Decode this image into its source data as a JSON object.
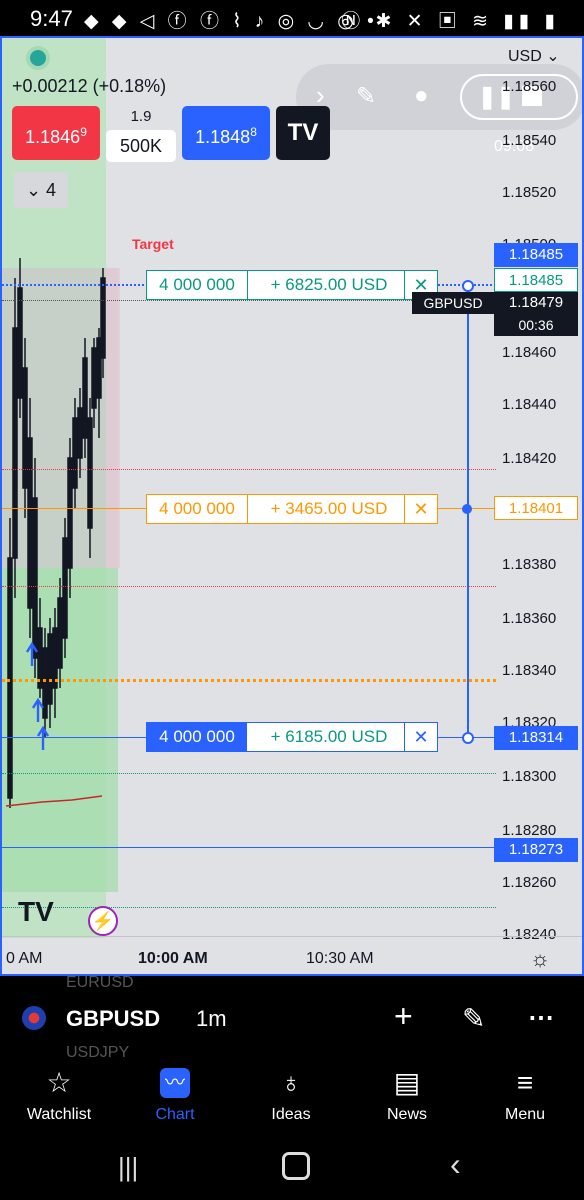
{
  "status_bar": {
    "time": "9:47",
    "left_icons": "◆ ◆ ◁ ⓕ ⓕ ⌇ ♪ ◎ ◡ ◎ •",
    "right_icons": "Ⓝ ✱ ✕ ▣ ≋ ▮▮ ▮"
  },
  "chart": {
    "currency": "USD",
    "change": "+0.00212 (+0.18%)",
    "sell_price_main": "1.1846",
    "sell_price_sup": "9",
    "spread": "1.9",
    "quantity": "500K",
    "buy_price_main": "1.1848",
    "buy_price_sup": "8",
    "indicators_count": "4",
    "target_label": "Target",
    "symbol_tag": "GBPUSD",
    "countdown": "00:36",
    "overlay_time": "09:08",
    "price_ticks": [
      "1.18560",
      "1.18540",
      "1.18520",
      "1.18500",
      "1.18460",
      "1.18440",
      "1.18420",
      "1.18380",
      "1.18360",
      "1.18340",
      "1.18320",
      "1.18300",
      "1.18280",
      "1.18260",
      "1.18240"
    ],
    "tags": {
      "top_blue": "1.18485",
      "green": "1.18485",
      "current": "1.18479",
      "orange": "1.18401",
      "stop": "1.18314",
      "low": "1.18273"
    },
    "orders": {
      "take_profit": {
        "qty": "4 000 000",
        "pnl": "+ 6825.00 USD",
        "close": "✕"
      },
      "position": {
        "qty": "4 000 000",
        "pnl": "+ 3465.00 USD",
        "close": "✕"
      },
      "stop_loss": {
        "qty": "4 000 000",
        "pnl": "+ 6185.00 USD",
        "close": "✕"
      }
    },
    "time_labels": [
      "0 AM",
      "10:00 AM",
      "10:30 AM"
    ],
    "colors": {
      "sell": "#f23645",
      "buy": "#2962ff",
      "profit": "#089981",
      "position": "#ff9800",
      "background": "#e0e1e5"
    }
  },
  "toolbar": {
    "ghost_above": "EURUSD",
    "symbol": "GBPUSD",
    "interval": "1m",
    "ghost_below": "USDJPY"
  },
  "nav": {
    "items": [
      {
        "label": "Watchlist"
      },
      {
        "label": "Chart"
      },
      {
        "label": "Ideas"
      },
      {
        "label": "News"
      },
      {
        "label": "Menu"
      }
    ]
  }
}
